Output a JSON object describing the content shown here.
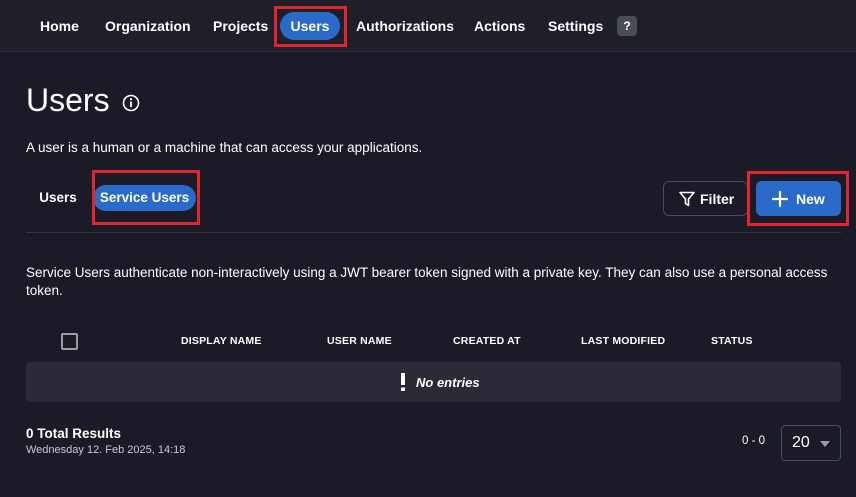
{
  "nav": {
    "items": [
      {
        "label": "Home"
      },
      {
        "label": "Organization"
      },
      {
        "label": "Projects"
      },
      {
        "label": "Users"
      },
      {
        "label": "Authorizations"
      },
      {
        "label": "Actions"
      },
      {
        "label": "Settings"
      }
    ],
    "help": "?"
  },
  "page": {
    "title": "Users",
    "description": "A user is a human or a machine that can access your applications."
  },
  "subtabs": [
    {
      "label": "Users"
    },
    {
      "label": "Service Users"
    }
  ],
  "toolbar": {
    "filter_label": "Filter",
    "new_label": "New"
  },
  "section": {
    "description": "Service Users authenticate non-interactively using a JWT bearer token signed with a private key. They can also use a personal access token."
  },
  "table": {
    "columns": [
      "DISPLAY NAME",
      "USER NAME",
      "CREATED AT",
      "LAST MODIFIED",
      "STATUS"
    ],
    "empty_text": "No entries"
  },
  "footer": {
    "total": "0 Total Results",
    "timestamp": "Wednesday 12. Feb 2025, 14:18",
    "range": "0 - 0",
    "page_size": "20"
  },
  "colors": {
    "accent": "#2a6ac9",
    "background": "#1a1b26",
    "highlight": "#e0252c"
  }
}
